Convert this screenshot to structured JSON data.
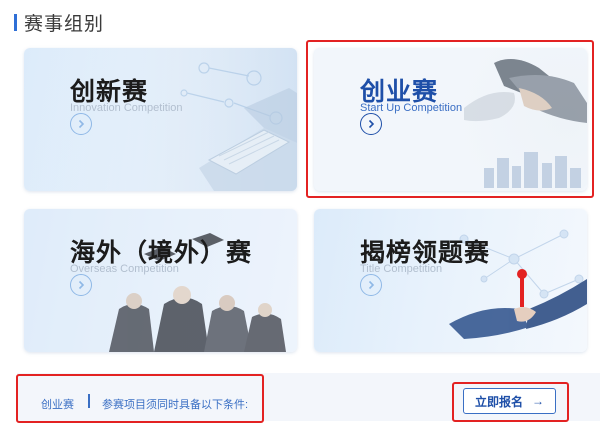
{
  "section": {
    "title": "赛事组别"
  },
  "cards": [
    {
      "title": "创新赛",
      "subtitle": "Innovation Competition",
      "icon": "arrow-right-circle-icon",
      "art": "laptop-tech-illustration"
    },
    {
      "title": "创业赛",
      "subtitle": "Start Up Competition",
      "icon": "arrow-right-circle-icon",
      "art": "handshake-business-photo",
      "selected": true
    },
    {
      "title": "海外（境外）赛",
      "subtitle": "Overseas Competition",
      "icon": "arrow-right-circle-icon",
      "art": "graduates-photo"
    },
    {
      "title": "揭榜领题赛",
      "subtitle": "Title Competition",
      "icon": "arrow-right-circle-icon",
      "art": "handshake-network-photo"
    }
  ],
  "info": {
    "category": "创业赛",
    "separator": "|",
    "condition": "参赛项目须同时具备以下条件:"
  },
  "apply_button": {
    "label": "立即报名",
    "arrow": "→"
  },
  "colors": {
    "accent": "#1e4fa8",
    "link": "#3a6fc4",
    "highlight": "#e32222",
    "card_bg": "#e8f2fc"
  }
}
